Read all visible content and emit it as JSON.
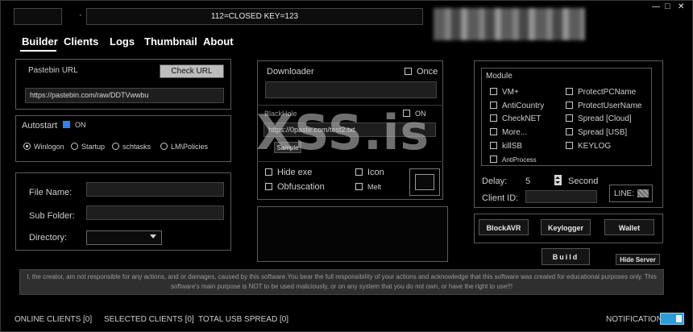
{
  "titlebar": {
    "status": "112=CLOSED   KEY=123",
    "minimize": "—",
    "maximize": "□",
    "close": "✕"
  },
  "tabs": [
    "Builder",
    "Clients",
    "Logs",
    "Thumbnail",
    "About"
  ],
  "pastebin": {
    "label": "Pastebin URL",
    "check_button": "Check URL",
    "url": "https://pastebin.com/raw/DDTVwwbu"
  },
  "autostart": {
    "label": "Autostart",
    "toggle_label": "ON",
    "options": [
      "Winlogon",
      "Startup",
      "schtasks",
      "LM\\Policies"
    ]
  },
  "file": {
    "file_name_label": "File Name:",
    "sub_folder_label": "Sub Folder:",
    "directory_label": "Directory:"
  },
  "downloader": {
    "label": "Downloader",
    "once_label": "Once"
  },
  "blackhole": {
    "label": "BlackHole",
    "on_label": "ON",
    "url": "https://0paste.com/test2.txt",
    "sample_button": "Sample"
  },
  "options": {
    "hide_exe": "Hide exe",
    "icon": "Icon",
    "obfuscation": "Obfuscation",
    "melt": "Melt"
  },
  "module": {
    "title": "Module",
    "left": [
      "VM+",
      "AntiCountry",
      "CheckNET",
      "More...",
      "killSB",
      "AntiProcess"
    ],
    "right": [
      "ProtectPCName",
      "ProtectUserName",
      "Spread [Cloud]",
      "Spread [USB]",
      "KEYLOG"
    ]
  },
  "delay": {
    "label": "Delay:",
    "value": "5",
    "unit": "Second"
  },
  "client_id": {
    "label": "Client ID:"
  },
  "line": {
    "label": "LINE:"
  },
  "buttons": {
    "blockavr": "BlockAVR",
    "keylogger": "Keylogger",
    "wallet": "Wallet",
    "build": "Build",
    "hide_server": "Hide Server"
  },
  "disclaimer": "I, the creator, am not responsible for any actions, and or damages, caused by this software.You bear the full responsibility of your actions and acknowledge that this software was created for educational purposes only. This software's main purpose is NOT to be used maliciously, or on any system that you do not own, or have the right to use!!!",
  "watermark": "XSS.is",
  "status": {
    "online": "ONLINE CLIENTS [0]",
    "selected": "SELECTED CLIENTS [0]",
    "usb": "TOTAL USB SPREAD [0]",
    "notification": "NOTIFICATION"
  },
  "colors": {
    "accent": "#2f9bd6",
    "background": "#000000",
    "border": "#5b5b5b"
  }
}
